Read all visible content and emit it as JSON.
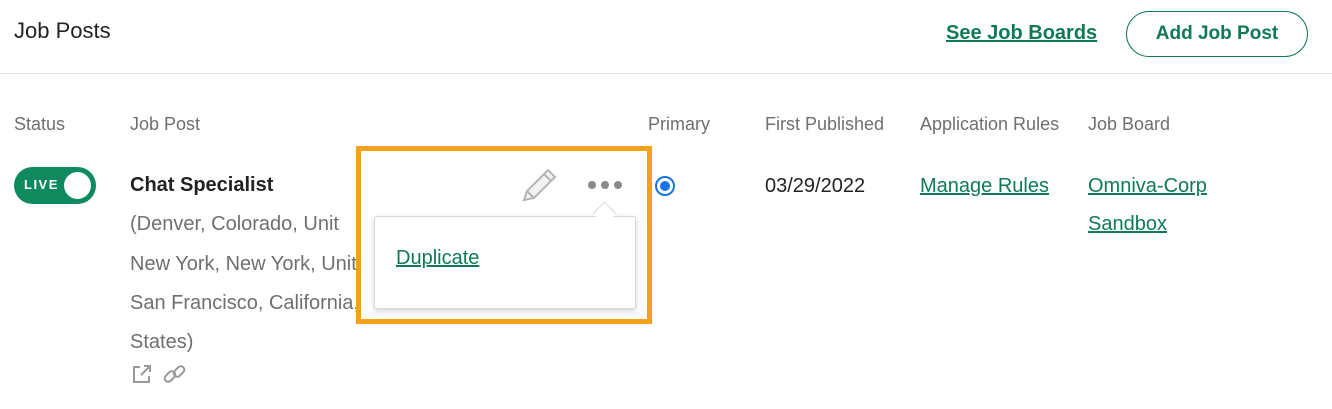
{
  "header": {
    "title": "Job Posts",
    "see_job_boards": "See Job Boards",
    "add_job_post": "Add Job Post"
  },
  "columns": {
    "status": "Status",
    "job_post": "Job Post",
    "primary": "Primary",
    "first_published": "First Published",
    "application_rules": "Application Rules",
    "job_board": "Job Board"
  },
  "row": {
    "status_label": "LIVE",
    "status_on": true,
    "title": "Chat Specialist",
    "location_lines": [
      "(Denver, Colorado, Unit",
      "New York, New York, Unit",
      "San Francisco, California,",
      "States)"
    ],
    "primary_selected": true,
    "first_published": "03/29/2022",
    "rules_link": "Manage Rules",
    "job_board_lines": [
      "Omniva-Corp",
      "Sandbox"
    ]
  },
  "actions_menu": {
    "items": [
      "Duplicate"
    ]
  },
  "icons": {
    "external_link": "external-link-icon",
    "copy_link": "link-icon",
    "edit": "pencil-icon",
    "more": "more-options-icon"
  },
  "colors": {
    "brand_green": "#0f7a55",
    "toggle_green": "#0f8a5f",
    "highlight_orange": "#f5a11e",
    "radio_blue": "#1a73e8"
  }
}
